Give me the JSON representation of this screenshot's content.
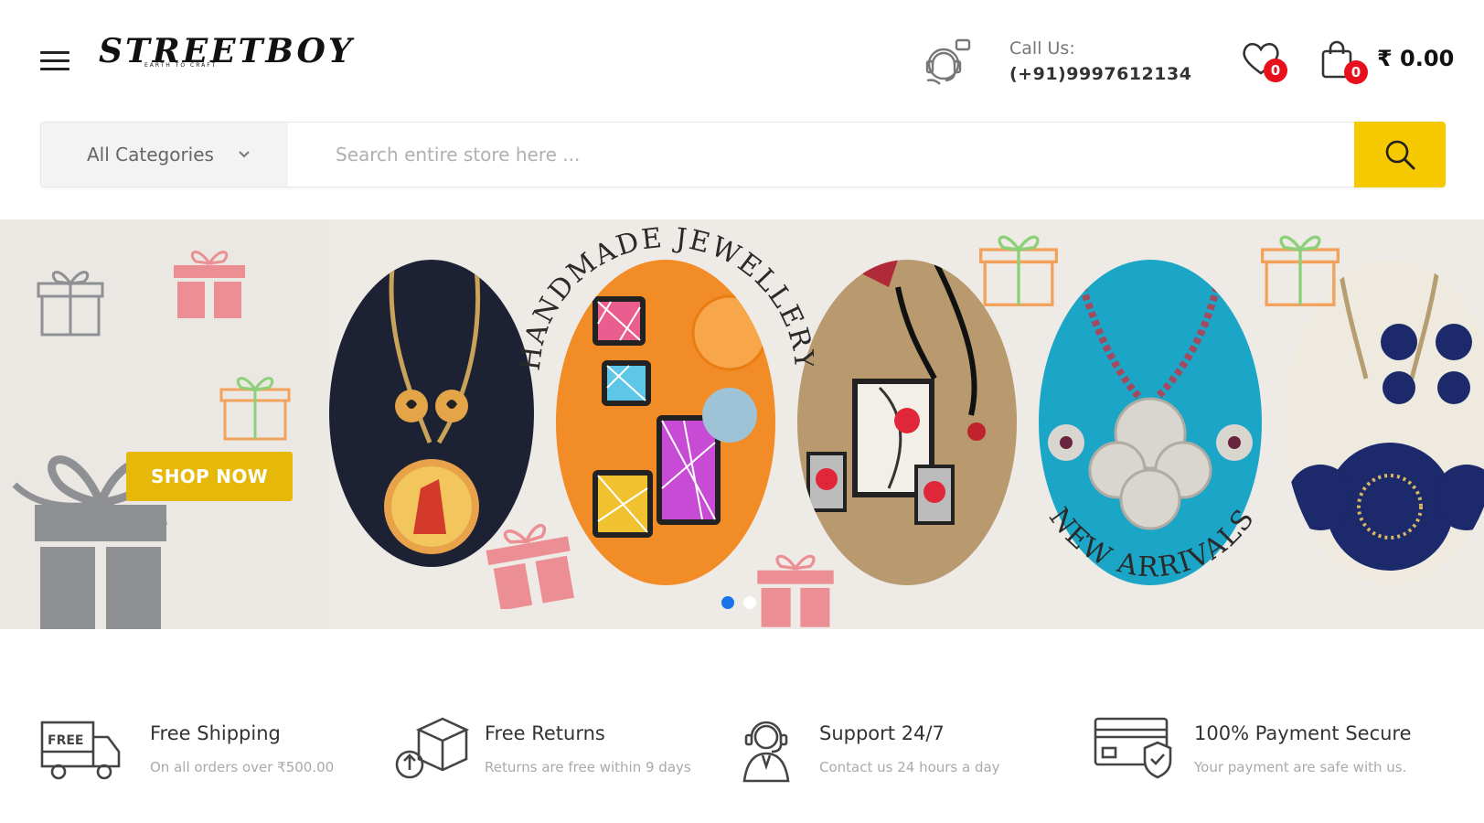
{
  "header": {
    "logo_text": "STREETBOY",
    "logo_tagline": "EARTH TO CRAFT",
    "call_label": "Call Us:",
    "call_number": "(+91)9997612134",
    "wishlist_count": "0",
    "cart_count": "0",
    "cart_total": "₹ 0.00"
  },
  "search": {
    "category_label": "All Categories",
    "placeholder": "Search entire store here ..."
  },
  "hero": {
    "shop_now_label": "SHOP NOW",
    "heading_top": "HANDMADE JEWELLERY",
    "heading_bottom": "NEW ARRIVALS",
    "slides": [
      "slide-1",
      "slide-2"
    ],
    "active_slide": 0,
    "colors": {
      "background": "#eeebe6",
      "button": "#e6b80a",
      "gift_pink": "#ec8f95",
      "gift_gray": "#8f9094",
      "gift_green": "#8dd07a",
      "gift_orange": "#f2a25a"
    }
  },
  "features": [
    {
      "icon": "free-shipping-truck-icon",
      "title": "Free Shipping",
      "desc": "On all orders over ₹500.00"
    },
    {
      "icon": "returns-box-icon",
      "title": "Free Returns",
      "desc": "Returns are free within 9 days"
    },
    {
      "icon": "support-agent-icon",
      "title": "Support 24/7",
      "desc": "Contact us 24 hours a day"
    },
    {
      "icon": "secure-payment-card-icon",
      "title": "100% Payment Secure",
      "desc": "Your payment are safe with us."
    }
  ],
  "colors": {
    "accent_yellow": "#f5c800",
    "badge_red": "#e8101c",
    "dot_active": "#1a73e8"
  }
}
